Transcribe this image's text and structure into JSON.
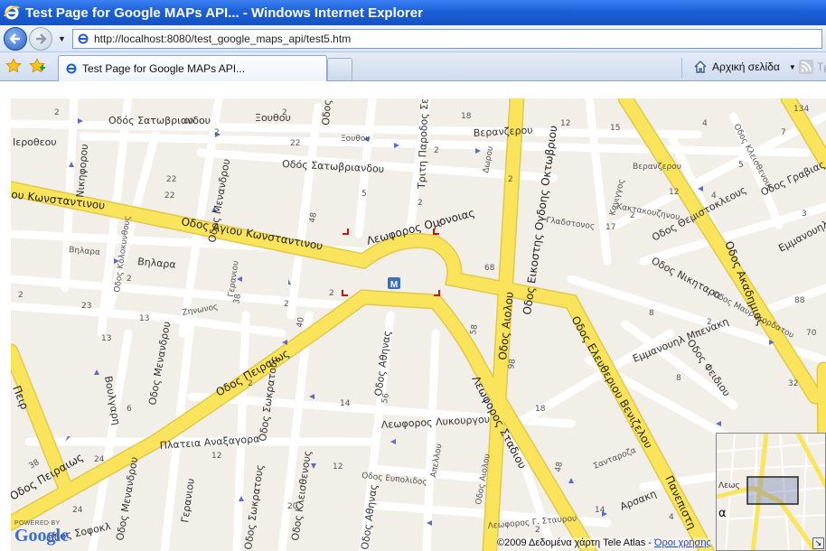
{
  "window": {
    "title": "Test Page for Google MAPs API... - Windows Internet Explorer"
  },
  "toolbar": {
    "url": "http://localhost:8080/test_google_maps_api/test5.htm"
  },
  "tabs": {
    "active_label": "Test Page for Google MAPs API...",
    "home_label": "Αρχική σελίδα",
    "feeds_label": "Τρ"
  },
  "map": {
    "streets": {
      "satovriandou_top": "Οδός Σατωβριανδου",
      "satovriandou_mid": "Οδός Σατωβριανδου",
      "xouthou": "Ξουθου",
      "xouthou_small": "Ξουθου",
      "veranzerou": "Βερανζερου",
      "veranzerou_small": "Βερανζερου",
      "ierothiou": "Ιεροθεου",
      "nikiforou": "Νικηφορου",
      "konstantinou_left": "ου Κωνσταντινου",
      "agiou_konstantinou": "Οδος Αγιου Κωνσταντινου",
      "menandrou_top": "Οδος Μενανδρου",
      "omonoias": "Λεωφορος Ομονοιας",
      "trith_parodos": "Τριτη Παροδος Σεπτε",
      "dorou": "Δωρου",
      "28oktovriou": "Οδος Εικοστης Ογδοης Οκτωβριου",
      "kaningos": "Κανιγγος",
      "kantakouzinou": "Κακτακουζηνου",
      "gladstonos": "Γλαδστονος",
      "themistokleous": "Οδος Θεμιστοκλεους",
      "akadimias": "Οδος Ακαδημιας",
      "grabias": "Οδος Γραβιας",
      "emmanouil_right": "Εμμανουηλ",
      "klisthenous": "Οδος Κλεισθενους",
      "nikitara": "Οδος Νικηταρα",
      "mavrokordatou": "Οδος Μαυροκορδατου",
      "emmanouil_benaki": "Εμμανουηλ Μπενακη",
      "feidiou": "Οδος Φειδιου",
      "eleftheriou_venizelou": "Οδος Ελευθεριου Βενιζελου",
      "aiolou": "Οδος Αιολου",
      "stadiou": "Λεωφορος Σταδιου",
      "athinas": "Οδος Αθηνας",
      "athinas_bottom": "Οδος Αθηνας",
      "lykourgou": "Λεωφορος Λυκουργου",
      "apellou": "Απελλου",
      "aiolou_small": "Οδος Αιολου",
      "evripidou": "Οδος Ευπολιδος",
      "santaroza": "Σανταροζα",
      "arsaki": "Αρσακη",
      "panepistimiou": "Πανεπιστη",
      "g_stratou": "Λεωφορος Γ. Σταυρου",
      "vilara_small": "Βηλαρα",
      "vilara": "Βηλαρα",
      "kolokynthous": "Οδος Κολοκυνθους",
      "geraniou_top": "Γερανιου",
      "geraniou_bottom": "Γερανιου",
      "zinonos": "Ζηνωνος",
      "sokratous_mid": "Οδος Σωκρατους",
      "sokratous_bottom": "Οδος Σωκρατους",
      "kleisthenous_bottom": "Οδος Κλεισθενους",
      "menandrou_mid": "Οδος Μενανδρου",
      "menandrou_bottom": "Οδος Μενανδρου",
      "voulgari": "Βουλγαρη",
      "peiraios_mid": "Οδος Πειραιως",
      "peiraios_bottom": "Οδος Πειραιως",
      "peiraios_left": "Πειρ",
      "plateia_anaxagora": "Πλατεια Αναξαγορα",
      "sofokleous": "Οδος Σοφοκλ",
      "odos_s": "Οδος Σ"
    },
    "numbers": [
      "2",
      "40",
      "2",
      "2",
      "22",
      "18",
      "2",
      "12",
      "15",
      "134",
      "7",
      "4",
      "5",
      "2",
      "22",
      "22",
      "2",
      "6",
      "48",
      "68",
      "2",
      "17",
      "12",
      "4",
      "2",
      "5",
      "3",
      "2",
      "23",
      "2",
      "13",
      "13",
      "38",
      "40",
      "2",
      "58",
      "98",
      "18",
      "8",
      "88",
      "70",
      "32",
      "24",
      "38",
      "6",
      "24",
      "14",
      "12",
      "12",
      "56",
      "48",
      "2",
      "14",
      "4",
      "20",
      "2",
      "8",
      "2"
    ],
    "metro_label": "M",
    "powered_by": "POWERED BY",
    "google": "Google",
    "copyright": "©2009 Δεδομένα χάρτη Tele Atlas - ",
    "terms_link": "Όροι χρήσης",
    "overview_label": "Λεως",
    "overview_letter": "α"
  },
  "colors": {
    "road_major": "#fae45c",
    "road_major_edge": "#e2c94a",
    "road_minor": "#ffffff",
    "map_bg": "#f2efe9",
    "ie_blue": "#1c5fd6"
  }
}
